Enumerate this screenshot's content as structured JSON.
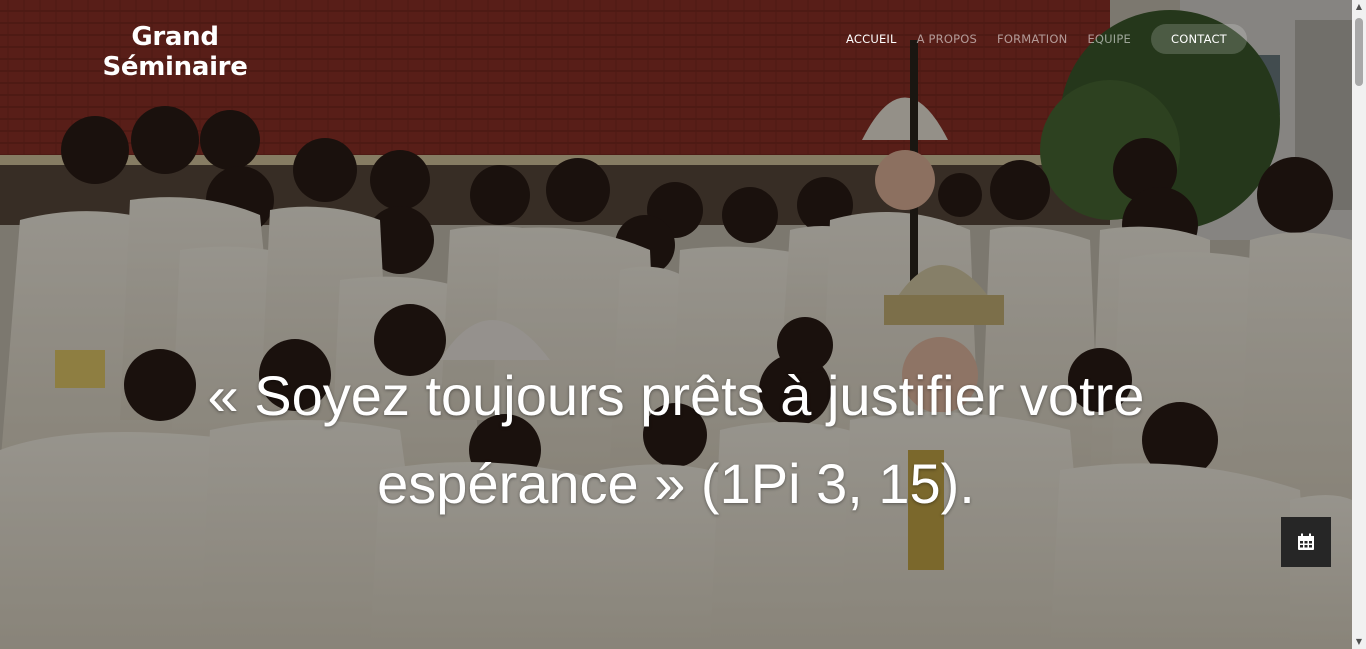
{
  "brand": {
    "line1": "Grand",
    "line2": "Séminaire"
  },
  "nav": {
    "items": [
      {
        "label": "ACCUEIL",
        "active": true
      },
      {
        "label": "A PROPOS",
        "active": false
      },
      {
        "label": "FORMATION",
        "active": false
      },
      {
        "label": "EQUIPE",
        "active": false
      },
      {
        "label": "CONTACT",
        "active": false
      }
    ]
  },
  "hero": {
    "quote_line1": "« Soyez toujours prêts à justifier votre",
    "quote_line2": "espérance » (1Pi 3, 15)."
  },
  "floating_button": {
    "icon": "calendar-icon"
  },
  "colors": {
    "overlay": "#000000",
    "text": "#ffffff",
    "roof": "#8a2f26",
    "robe": "#efe9dc"
  }
}
